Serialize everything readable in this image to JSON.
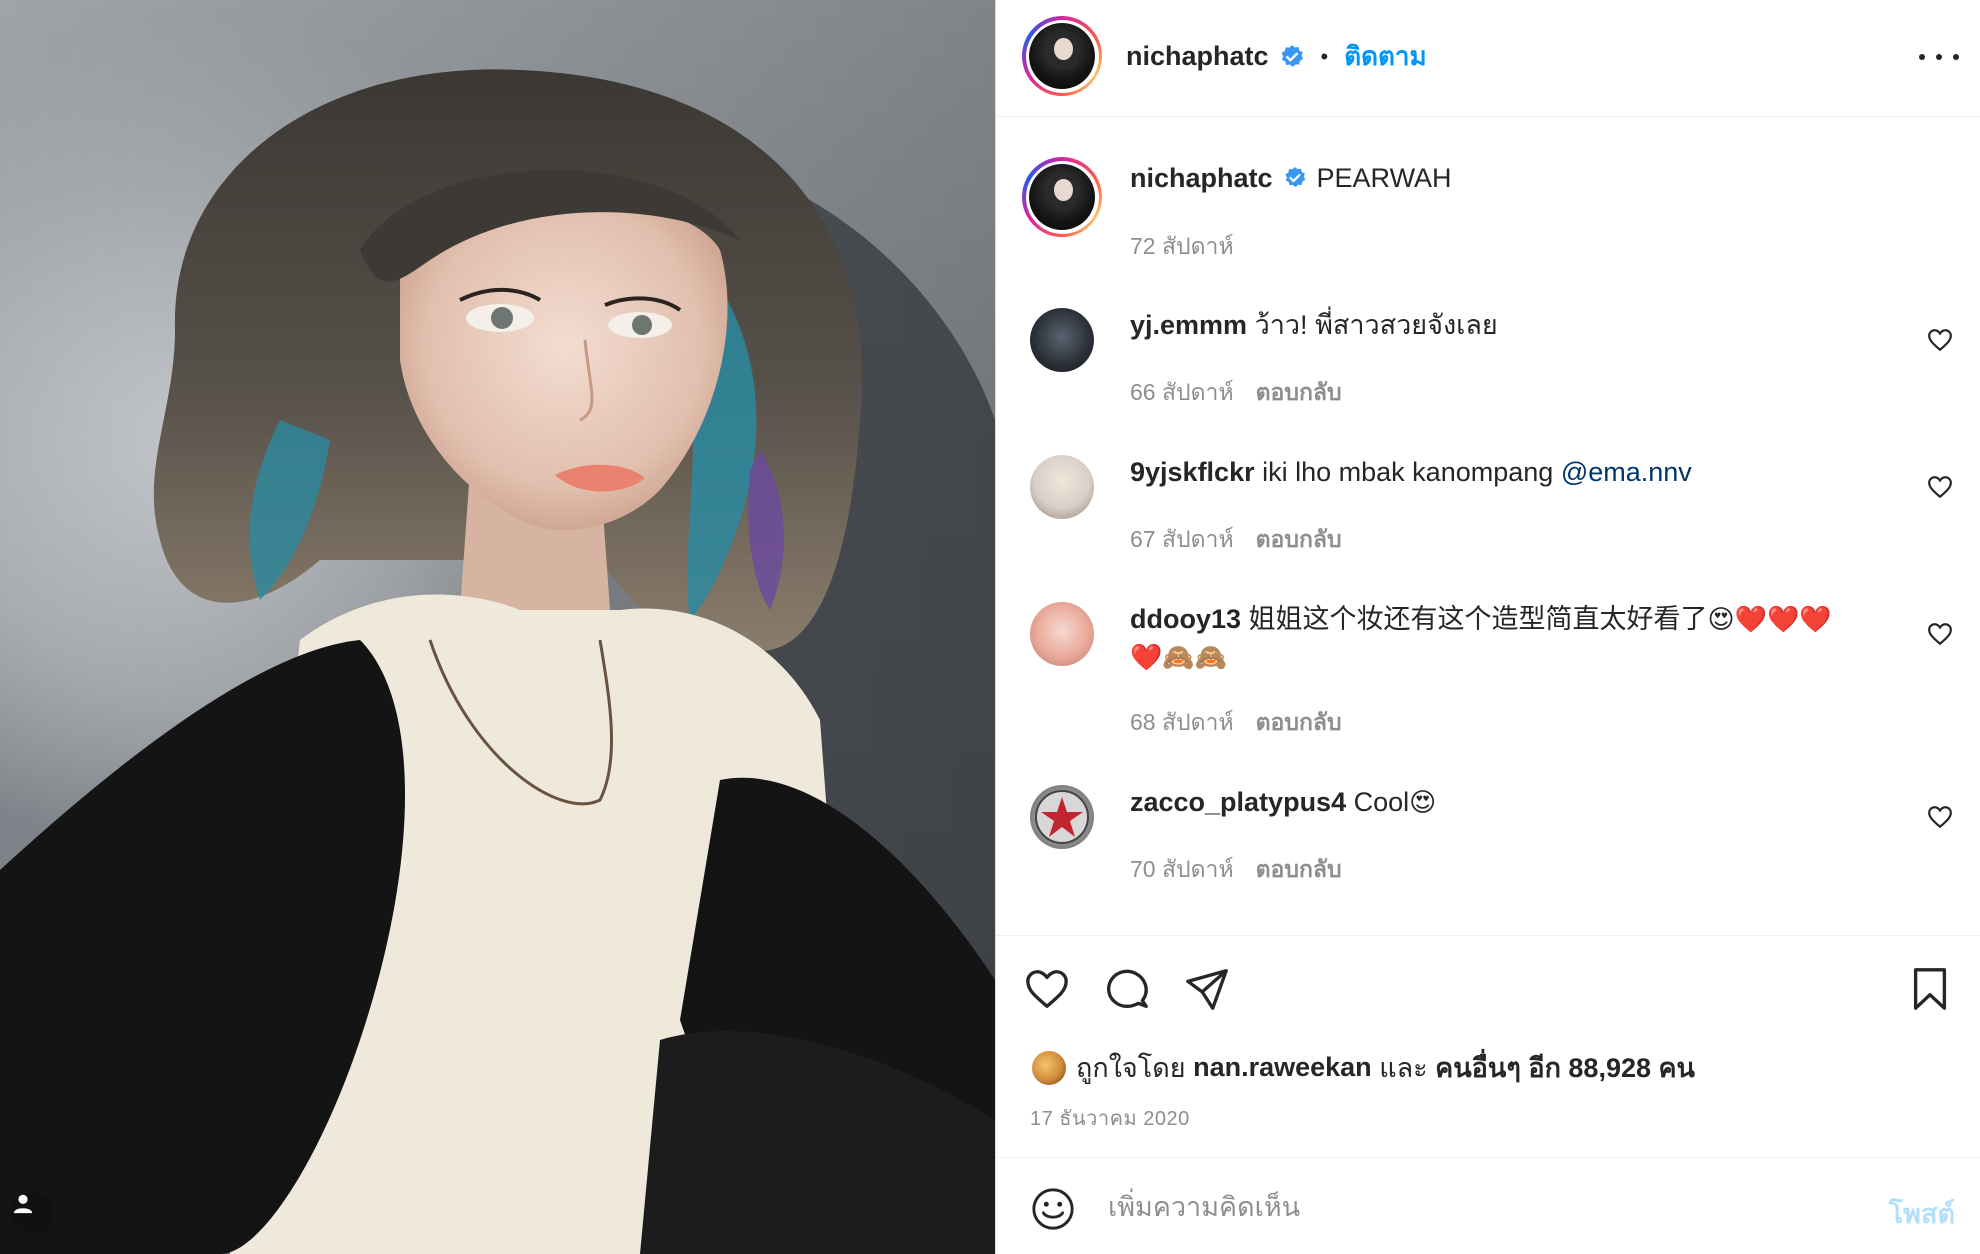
{
  "post": {
    "author": "nichaphatc",
    "follow_label": "ติดตาม",
    "separator": "•",
    "caption_text": "PEARWAH",
    "caption_time": "72 สัปดาห์"
  },
  "comments": [
    {
      "user": "yj.emmm",
      "text": "ว้าว! พี่สาวสวยจังเลย",
      "time": "66 สัปดาห์",
      "reply": "ตอบกลับ"
    },
    {
      "user": "9yjskflckr",
      "text": "iki lho mbak kanompang",
      "mention": "@ema.nnv",
      "time": "67 สัปดาห์",
      "reply": "ตอบกลับ"
    },
    {
      "user": "ddooy13",
      "text": "姐姐这个妆还有这个造型简直太好看了",
      "emoji_line1": "😍❤️❤️❤️",
      "emoji_line2": "❤️🙈🙈",
      "time": "68 สัปดาห์",
      "reply": "ตอบกลับ"
    },
    {
      "user": "zacco_platypus4",
      "text": "Cool",
      "emoji": "😍",
      "time": "70 สัปดาห์",
      "reply": "ตอบกลับ"
    }
  ],
  "likes": {
    "prefix": "ถูกใจโดย",
    "user": "nan.raweekan",
    "and": "และ",
    "others": "คนอื่นๆ อีก 88,928 คน"
  },
  "post_date": "17 ธันวาคม 2020",
  "composer": {
    "placeholder": "เพิ่มความคิดเห็น",
    "post_label": "โพสต์"
  },
  "colors": {
    "link_blue": "#0095f6",
    "verified_blue": "#3897f0",
    "muted_text": "#8e8e8e",
    "post_disabled": "#b2dffc"
  }
}
